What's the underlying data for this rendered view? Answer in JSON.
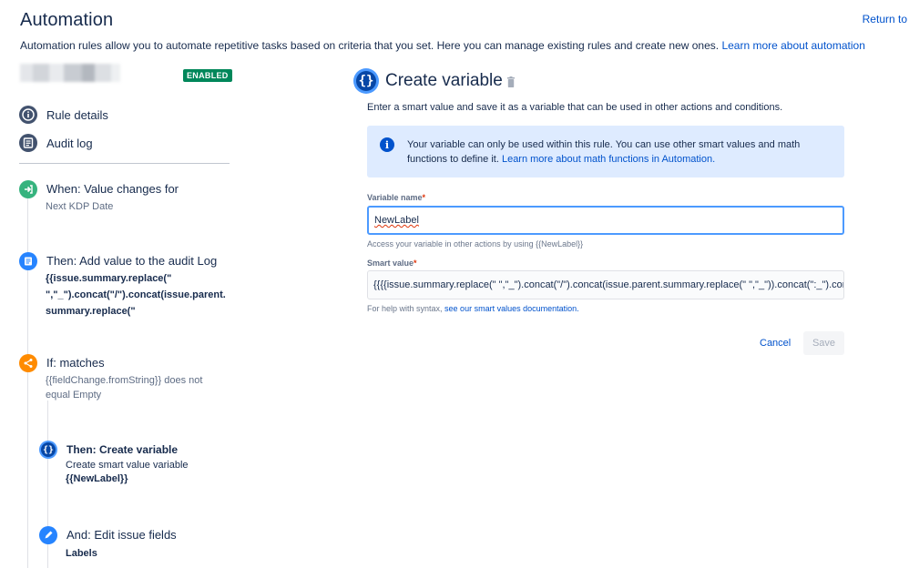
{
  "header": {
    "title": "Automation",
    "return_link": "Return to",
    "intro_text": "Automation rules allow you to automate repetitive tasks based on criteria that you set. Here you can manage existing rules and create new ones. ",
    "intro_link": "Learn more about automation"
  },
  "rule": {
    "status_badge": "ENABLED",
    "status_color": "#00875a"
  },
  "nav": {
    "rule_details": "Rule details",
    "audit_log": "Audit log"
  },
  "steps": [
    {
      "title": "When: Value changes for",
      "sub": "Next KDP Date",
      "color": "#36b37e",
      "icon": "trigger-icon"
    },
    {
      "title": "Then: Add value to the audit Log",
      "code_lines": [
        "{{issue.summary.replace(\"",
        "\",\"_\").concat(\"/\").concat(issue.parent.",
        "summary.replace(\""
      ],
      "color": "#2684ff",
      "icon": "audit-log-icon"
    },
    {
      "title": "If: matches",
      "sub_lines": [
        "{{fieldChange.fromString}} does not",
        "equal Empty"
      ],
      "color": "#ff8b00",
      "icon": "branch-icon"
    },
    {
      "title": "Then: Create variable",
      "sub": "Create smart value variable",
      "code": "{{NewLabel}}",
      "color": "#0747a6",
      "icon": "variable-icon"
    },
    {
      "title": "And: Edit issue fields",
      "code": "Labels",
      "color": "#2684ff",
      "icon": "pencil-icon"
    }
  ],
  "panel": {
    "title": "Create variable",
    "description": "Enter a smart value and save it as a variable that can be used in other actions and conditions.",
    "info_text": "Your variable can only be used within this rule. You can use other smart values and math functions to define it. ",
    "info_link": "Learn more about math functions in Automation.",
    "variable_name_label": "Variable name",
    "variable_name_value": "NewLabel",
    "variable_helper": "Access your variable in other actions by using {{NewLabel}}",
    "smart_value_label": "Smart value",
    "smart_value_value": "{{{{issue.summary.replace(\" \",\"_\").concat(\"/\").concat(issue.parent.summary.replace(\" \",\"_\")).concat(\":_\").concat(",
    "smart_helper_text": "For help with syntax, ",
    "smart_helper_link": "see our smart values documentation.",
    "cancel_label": "Cancel",
    "save_label": "Save"
  }
}
